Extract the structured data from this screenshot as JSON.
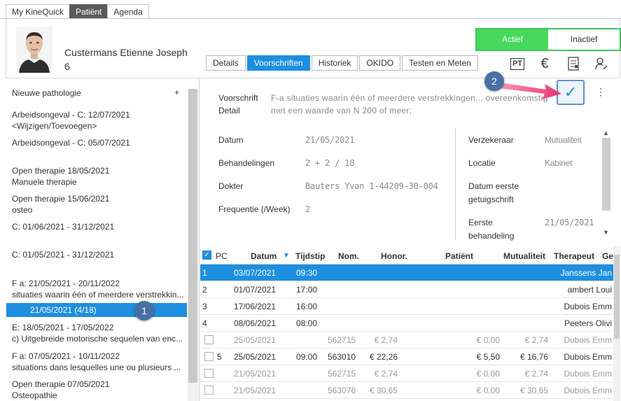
{
  "top_tabs": [
    "My KineQuick",
    "Patiënt",
    "Agenda"
  ],
  "patient": {
    "name": "Custermans Etienne Joseph",
    "number": "6"
  },
  "status_toggle": {
    "active": "Actief",
    "inactive": "Inactief"
  },
  "mid_tabs": [
    "Details",
    "Voorschriften",
    "Historiek",
    "OKIDO",
    "Testen en Meten"
  ],
  "tool_icons": {
    "pt": "PT",
    "euro": "€"
  },
  "sidebar": {
    "new_label": "Nieuwe pathologie",
    "plus": "+",
    "items": [
      {
        "line1": "Arbeidsongeval - C: 12/07/2021",
        "line2": "<Wijzigen/Toevoegen>"
      },
      {
        "line1": "Arbeidsongeval - C: 05/07/2021",
        "line2": ""
      },
      {
        "line1": "Open therapie 18/05/2021",
        "line2": "Manuele therapie"
      },
      {
        "line1": "Open therapie 15/06/2021",
        "line2": "osteo"
      },
      {
        "line1": "C: 01/06/2021 - 31/12/2021",
        "line2": ""
      },
      {
        "line1": "C: 01/05/2021 - 31/12/2021",
        "line2": ""
      },
      {
        "line1": "F a: 21/05/2021 - 20/11/2022",
        "line2": "situaties waarin één of meerdere verstrekkin..."
      },
      {
        "line1": "E: 18/05/2021 - 17/05/2022",
        "line2": "c) Uitgebreide motorische sequelen van enc..."
      },
      {
        "line1": "F a: 07/05/2021 - 10/11/2022",
        "line2": "situations dans lesquelles une ou plusieurs ..."
      },
      {
        "line1": "Open therapie 07/05/2021",
        "line2": "Osteopathie"
      }
    ],
    "selected_sub": "21/05/2021  (4/18)"
  },
  "prescription": {
    "label_line1": "Voorschrift",
    "label_line2": "Detail",
    "text_line1": "F-a situaties waarin één of meerdere verstrekkingen... overeenkomstig",
    "text_line2": "met een waarde van N 200 of meer;",
    "fields_left": [
      {
        "label": "Datum",
        "value": "21/05/2021"
      },
      {
        "label": "Behandelingen",
        "value": "2 + 2 / 18"
      },
      {
        "label": "Dokter",
        "value": "Bauters Yvan 1-44209-30-004"
      },
      {
        "label": "Frequentie (/Week)",
        "value": "2"
      }
    ],
    "fields_right": [
      {
        "label": "Verzekeraar",
        "value": "Mutualiteit"
      },
      {
        "label": "Locatie",
        "value": "Kabinet"
      },
      {
        "label": "Datum eerste getuigschrift",
        "value": ""
      },
      {
        "label": "Eerste behandeling",
        "value": "21/05/2021"
      }
    ],
    "label_datum_eerste_1": "Datum eerste",
    "label_datum_eerste_2": "getuigschrift",
    "label_eerste_1": "Eerste",
    "label_eerste_2": "behandeling",
    "confirm_glyph": "✓",
    "more_glyph": "⋮"
  },
  "badges": {
    "one": "1",
    "two": "2"
  },
  "table": {
    "headers": [
      "PC",
      "Datum",
      "Tijdstip",
      "Nom.",
      "Honor.",
      "Patiënt",
      "Mutualiteit",
      "Therapeut",
      "Ge"
    ],
    "rows": [
      {
        "pc": "1",
        "datum": "03/07/2021",
        "tijd": "09:30",
        "nom": "",
        "honor": "",
        "patient": "",
        "mut": "",
        "ther": "Janssens Jan",
        "cb": false,
        "dim": false
      },
      {
        "pc": "2",
        "datum": "01/07/2021",
        "tijd": "17:00",
        "nom": "",
        "honor": "",
        "patient": "",
        "mut": "",
        "ther": "ambert Loui",
        "cb": false,
        "dim": false
      },
      {
        "pc": "3",
        "datum": "17/06/2021",
        "tijd": "16:00",
        "nom": "",
        "honor": "",
        "patient": "",
        "mut": "",
        "ther": "Dubois Emm",
        "cb": false,
        "dim": false
      },
      {
        "pc": "4",
        "datum": "08/06/2021",
        "tijd": "08:00",
        "nom": "",
        "honor": "",
        "patient": "",
        "mut": "",
        "ther": "Peeters Olivi",
        "cb": false,
        "dim": false
      },
      {
        "pc": "",
        "datum": "25/05/2021",
        "tijd": "",
        "nom": "562715",
        "honor": "€ 2,74",
        "patient": "€ 0,00",
        "mut": "€ 2,74",
        "ther": "Dubois Emm",
        "cb": true,
        "dim": true
      },
      {
        "pc": "5",
        "datum": "25/05/2021",
        "tijd": "09:00",
        "nom": "563010",
        "honor": "€ 22,26",
        "patient": "€ 5,50",
        "mut": "€ 16,76",
        "ther": "Dubois Emm",
        "cb": true,
        "dim": false
      },
      {
        "pc": "",
        "datum": "21/05/2021",
        "tijd": "",
        "nom": "562715",
        "honor": "€ 2,74",
        "patient": "€ 0,00",
        "mut": "€ 2,74",
        "ther": "Dubois Emm",
        "cb": true,
        "dim": true
      },
      {
        "pc": "",
        "datum": "21/05/2021",
        "tijd": "",
        "nom": "563076",
        "honor": "€ 30,65",
        "patient": "€ 0,00",
        "mut": "€ 30,65",
        "ther": "Dubois Emm",
        "cb": true,
        "dim": true
      }
    ]
  },
  "colors": {
    "accent": "#1e8fe0",
    "active_green": "#47d95c",
    "badge": "#4a6fa5",
    "arrow": "#e8336b"
  }
}
